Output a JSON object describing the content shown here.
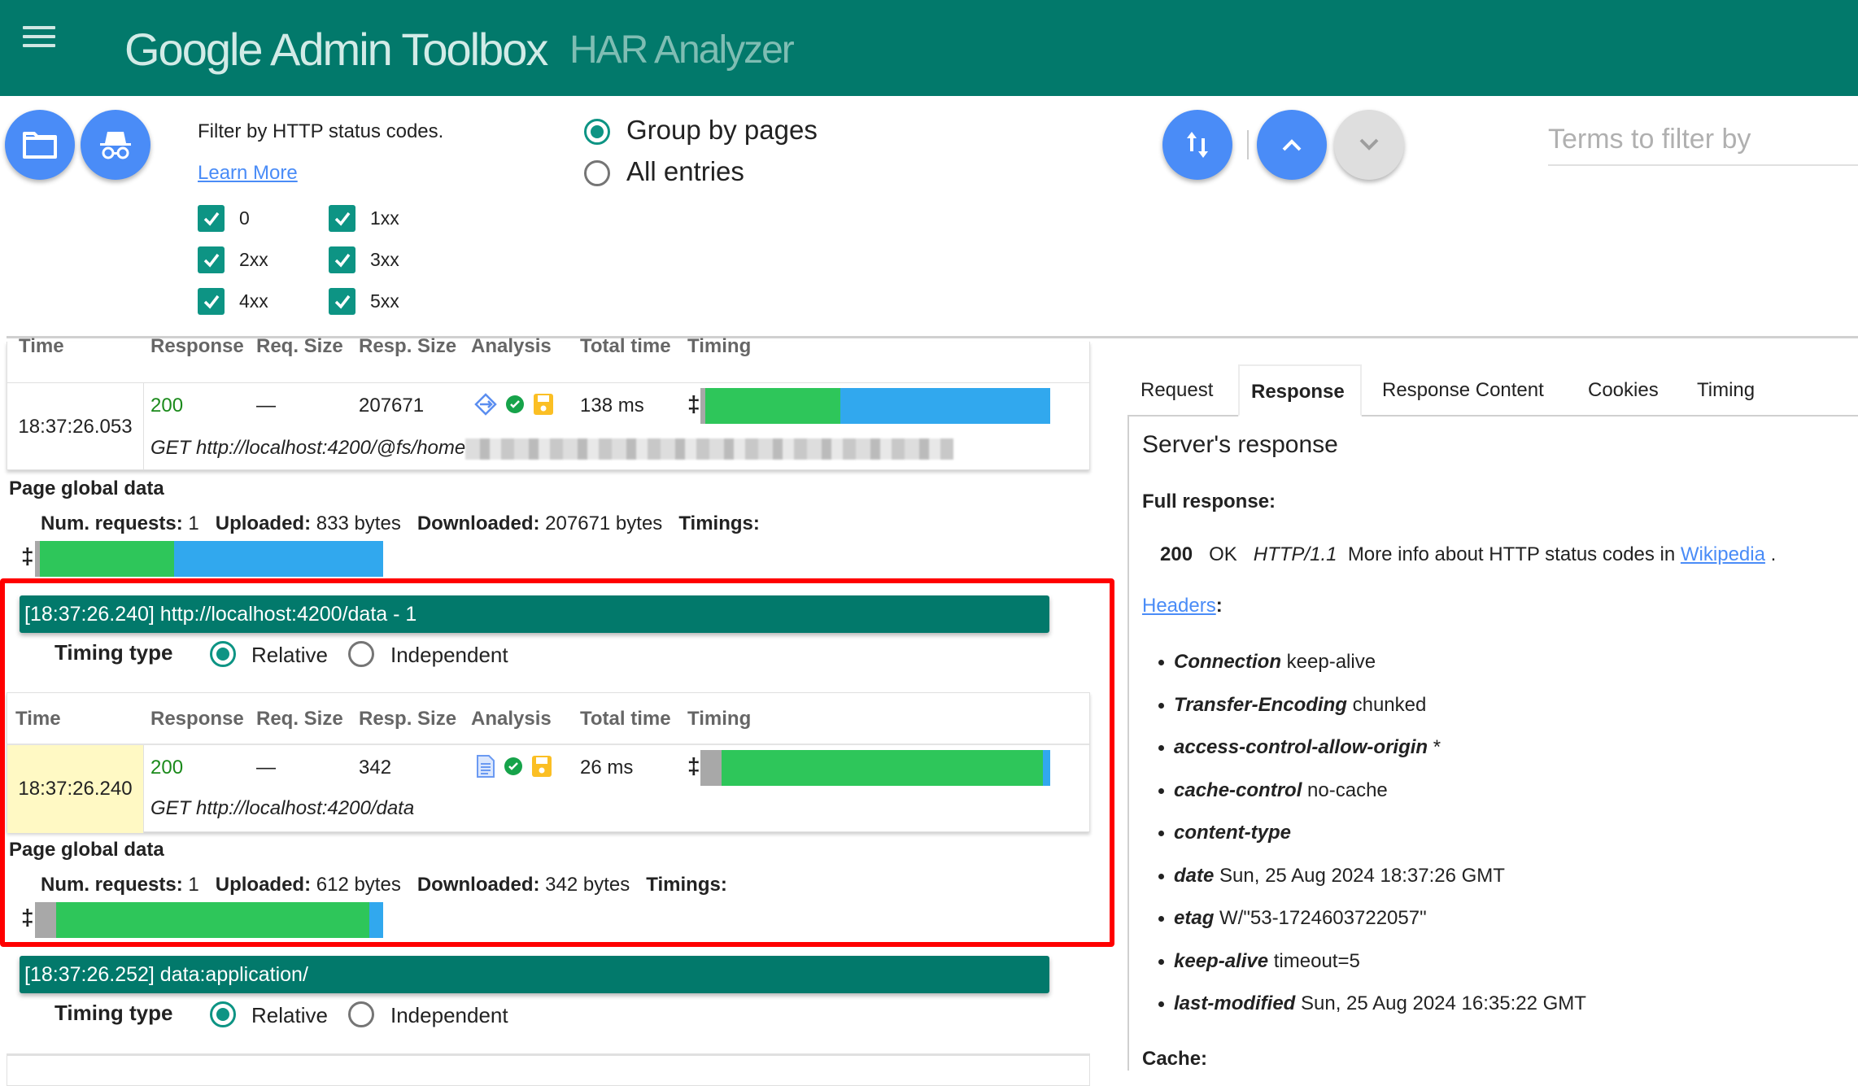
{
  "header": {
    "title": "Google Admin Toolbox",
    "subtitle": "HAR Analyzer",
    "brand_color": "#02796b"
  },
  "toolbar": {
    "open_file_icon": "folder-icon",
    "incognito_icon": "incognito-icon",
    "filter_label": "Filter by HTTP status codes.",
    "learn_more": "Learn More",
    "status_filters": [
      {
        "label": "0",
        "checked": true
      },
      {
        "label": "1xx",
        "checked": true
      },
      {
        "label": "2xx",
        "checked": true
      },
      {
        "label": "3xx",
        "checked": true
      },
      {
        "label": "4xx",
        "checked": true
      },
      {
        "label": "5xx",
        "checked": true
      }
    ],
    "grouping": {
      "options": [
        "Group by pages",
        "All entries"
      ],
      "selected": "Group by pages"
    },
    "sort_icon": "sort-icon",
    "prev_icon": "chevron-up-icon",
    "next_icon": "chevron-down-icon",
    "search_placeholder": "Terms to filter by",
    "search_value": ""
  },
  "columns": [
    "Time",
    "Response",
    "Req. Size",
    "Resp. Size",
    "Analysis",
    "Total time",
    "Timing"
  ],
  "pages": [
    {
      "entries": [
        {
          "time": "18:37:26.053",
          "status": "200",
          "req_size": "—",
          "resp_size": "207671",
          "analysis_icons": [
            "redirect-icon",
            "check-circle-icon",
            "cache-save-icon"
          ],
          "total_time": "138 ms",
          "timing_segments": [
            {
              "color": "#a8a8a8",
              "fraction": 0.015
            },
            {
              "color": "#2ec65a",
              "fraction": 0.385
            },
            {
              "color": "#31a8ee",
              "fraction": 0.6
            }
          ],
          "request_line": "GET http://localhost:4200/@fs/home"
        }
      ],
      "global": {
        "title": "Page global data",
        "num_requests_label": "Num. requests:",
        "num_requests": "1",
        "uploaded_label": "Uploaded:",
        "uploaded": "833 bytes",
        "downloaded_label": "Downloaded:",
        "downloaded": "207671 bytes",
        "timings_label": "Timings:",
        "timing_segments": [
          {
            "color": "#a8a8a8",
            "fraction": 0.015
          },
          {
            "color": "#2ec65a",
            "fraction": 0.385
          },
          {
            "color": "#31a8ee",
            "fraction": 0.6
          }
        ]
      }
    },
    {
      "header": "[18:37:26.240] http://localhost:4200/data - 1",
      "timing_type_label": "Timing type",
      "timing_type_options": [
        "Relative",
        "Independent"
      ],
      "timing_type_selected": "Relative",
      "entries": [
        {
          "time": "18:37:26.240",
          "status": "200",
          "req_size": "—",
          "resp_size": "342",
          "analysis_icons": [
            "document-icon",
            "check-circle-icon",
            "cache-save-icon"
          ],
          "total_time": "26 ms",
          "timing_segments": [
            {
              "color": "#a8a8a8",
              "fraction": 0.06
            },
            {
              "color": "#2ec65a",
              "fraction": 0.92
            },
            {
              "color": "#31a8ee",
              "fraction": 0.02
            }
          ],
          "request_line": "GET http://localhost:4200/data",
          "selected": true
        }
      ],
      "global": {
        "title": "Page global data",
        "num_requests_label": "Num. requests:",
        "num_requests": "1",
        "uploaded_label": "Uploaded:",
        "uploaded": "612 bytes",
        "downloaded_label": "Downloaded:",
        "downloaded": "342 bytes",
        "timings_label": "Timings:",
        "timing_segments": [
          {
            "color": "#a8a8a8",
            "fraction": 0.06
          },
          {
            "color": "#2ec65a",
            "fraction": 0.9
          },
          {
            "color": "#31a8ee",
            "fraction": 0.04
          }
        ]
      }
    },
    {
      "header": "[18:37:26.252] data:application/",
      "timing_type_label": "Timing type",
      "timing_type_options": [
        "Relative",
        "Independent"
      ],
      "timing_type_selected": "Relative"
    }
  ],
  "details": {
    "tabs": [
      "Request",
      "Response",
      "Response Content",
      "Cookies",
      "Timing"
    ],
    "active_tab": "Response",
    "title": "Server's response",
    "full_response_label": "Full response:",
    "status_code": "200",
    "status_text": "OK",
    "http_version": "HTTP/1.1",
    "more_info": "More info about HTTP status codes in",
    "wikipedia_link": "Wikipedia",
    "headers_link": "Headers",
    "headers": [
      {
        "name": "Connection",
        "value": "keep-alive"
      },
      {
        "name": "Transfer-Encoding",
        "value": "chunked"
      },
      {
        "name": "access-control-allow-origin",
        "value": "*"
      },
      {
        "name": "cache-control",
        "value": "no-cache"
      },
      {
        "name": "content-type",
        "value": ""
      },
      {
        "name": "date",
        "value": "Sun, 25 Aug 2024 18:37:26 GMT"
      },
      {
        "name": "etag",
        "value": "W/\"53-1724603722057\""
      },
      {
        "name": "keep-alive",
        "value": "timeout=5"
      },
      {
        "name": "last-modified",
        "value": "Sun, 25 Aug 2024 16:35:22 GMT"
      }
    ],
    "cache_label": "Cache:"
  },
  "highlight_color": "#ff0000"
}
